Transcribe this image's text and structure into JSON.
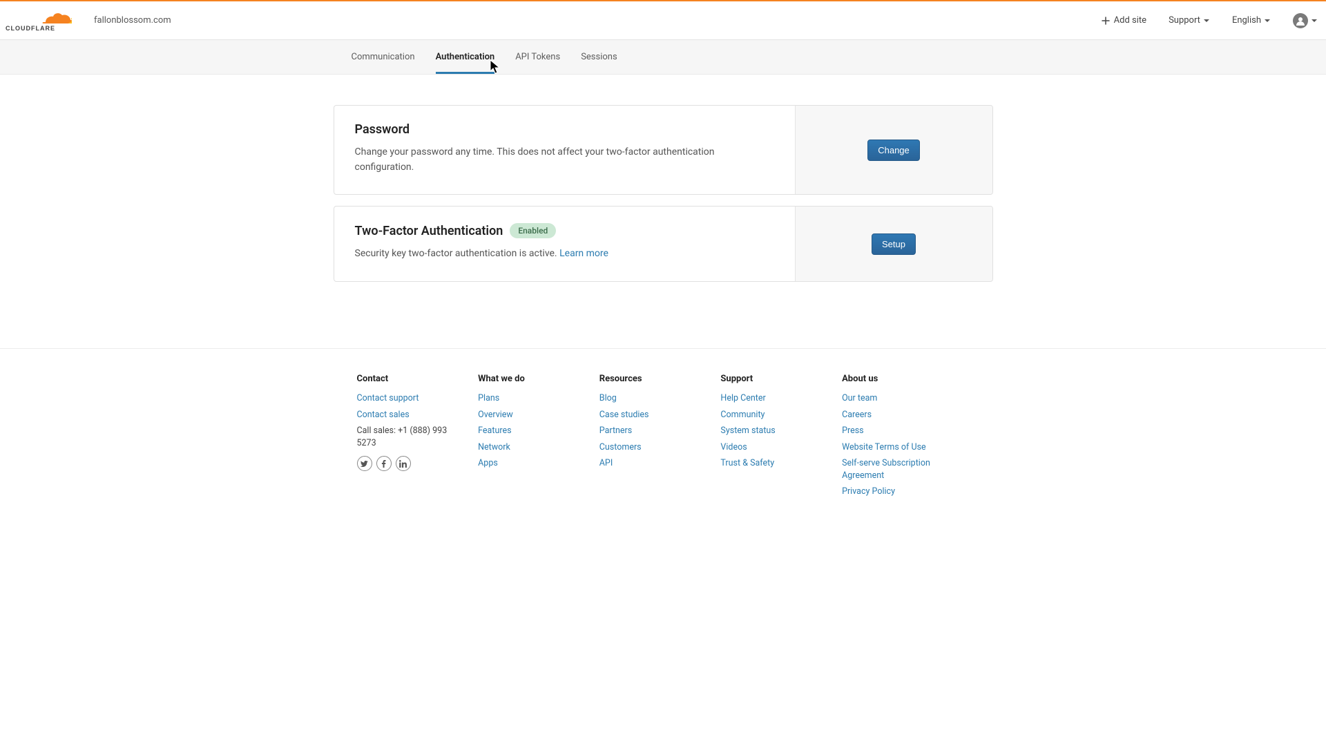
{
  "header": {
    "site_name": "fallonblossom.com",
    "add_site": "Add site",
    "support": "Support",
    "language": "English"
  },
  "tabs": [
    {
      "label": "Communication",
      "active": false
    },
    {
      "label": "Authentication",
      "active": true
    },
    {
      "label": "API Tokens",
      "active": false
    },
    {
      "label": "Sessions",
      "active": false
    }
  ],
  "cards": {
    "password": {
      "title": "Password",
      "desc": "Change your password any time. This does not affect your two-factor authentication configuration.",
      "button": "Change"
    },
    "two_factor": {
      "title": "Two-Factor Authentication",
      "badge": "Enabled",
      "desc_pre": "Security key two-factor authentication is active. ",
      "learn_more": "Learn more",
      "button": "Setup"
    }
  },
  "footer": {
    "contact": {
      "heading": "Contact",
      "links": [
        "Contact support",
        "Contact sales"
      ],
      "call": "Call sales: +1 (888) 993 5273"
    },
    "what_we_do": {
      "heading": "What we do",
      "links": [
        "Plans",
        "Overview",
        "Features",
        "Network",
        "Apps"
      ]
    },
    "resources": {
      "heading": "Resources",
      "links": [
        "Blog",
        "Case studies",
        "Partners",
        "Customers",
        "API"
      ]
    },
    "support": {
      "heading": "Support",
      "links": [
        "Help Center",
        "Community",
        "System status",
        "Videos",
        "Trust & Safety"
      ]
    },
    "about": {
      "heading": "About us",
      "links": [
        "Our team",
        "Careers",
        "Press",
        "Website Terms of Use",
        "Self-serve Subscription Agreement",
        "Privacy Policy"
      ]
    }
  }
}
